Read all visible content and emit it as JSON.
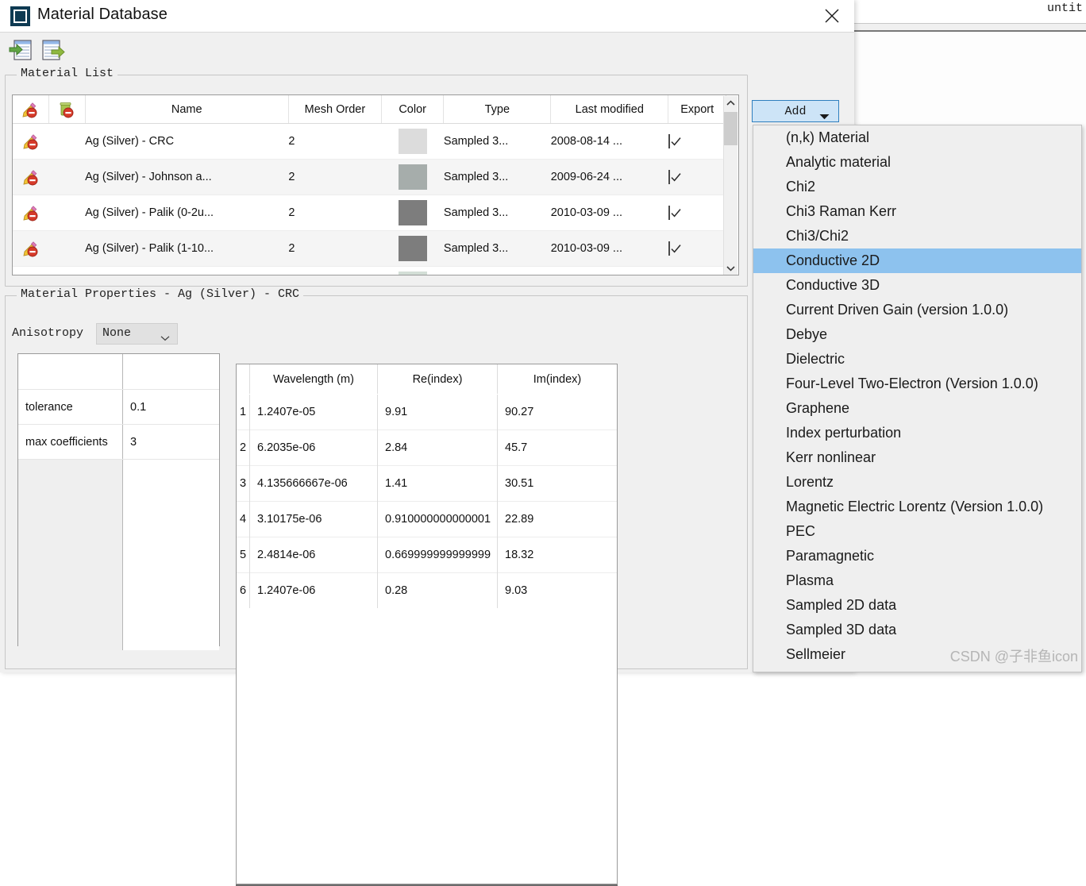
{
  "background_window": {
    "title": "untit"
  },
  "dialog": {
    "title": "Material Database",
    "icon": "app-window-icon",
    "close_label": "✕",
    "toolbar": [
      {
        "name": "import-material-button",
        "icon": "import-list-icon",
        "tooltip": "Import"
      },
      {
        "name": "export-material-button",
        "icon": "export-list-icon",
        "tooltip": "Export"
      }
    ]
  },
  "material_list": {
    "legend": "Material List",
    "columns": [
      "",
      "",
      "Name",
      "Mesh Order",
      "Color",
      "Type",
      "Last modified",
      "Export"
    ],
    "rows": [
      {
        "name": "Ag (Silver) - CRC",
        "mesh_order": "2",
        "color": "#dcdcdc",
        "type": "Sampled 3...",
        "last_modified": "2008-08-14 ...",
        "export": true
      },
      {
        "name": "Ag (Silver) - Johnson a...",
        "mesh_order": "2",
        "color": "#a6adab",
        "type": "Sampled 3...",
        "last_modified": "2009-06-24 ...",
        "export": true
      },
      {
        "name": "Ag (Silver) - Palik (0-2u...",
        "mesh_order": "2",
        "color": "#7d7d7d",
        "type": "Sampled 3...",
        "last_modified": "2010-03-09 ...",
        "export": true
      },
      {
        "name": "Ag (Silver) - Palik (1-10...",
        "mesh_order": "2",
        "color": "#7d7d7d",
        "type": "Sampled 3...",
        "last_modified": "2010-03-09 ...",
        "export": true
      },
      {
        "name": "",
        "mesh_order": "",
        "color": "#d3ded6",
        "type": "",
        "last_modified": "",
        "export": false
      }
    ],
    "scrollbar": {
      "up": "▲",
      "down": "▼"
    }
  },
  "material_properties": {
    "legend": "Material Properties - Ag (Silver) - CRC",
    "anisotropy": {
      "label": "Anisotropy",
      "value": "None"
    },
    "coefficients": [
      {
        "key": "tolerance",
        "value": "0.1"
      },
      {
        "key": "max coefficients",
        "value": "3"
      }
    ],
    "data_table": {
      "columns": [
        "Wavelength (m)",
        "Re(index)",
        "Im(index)"
      ],
      "rows": [
        {
          "index": "1",
          "wavelength": "1.2407e-05",
          "re_index": "9.91",
          "im_index": "90.27"
        },
        {
          "index": "2",
          "wavelength": "6.2035e-06",
          "re_index": "2.84",
          "im_index": "45.7"
        },
        {
          "index": "3",
          "wavelength": "4.135666667e-06",
          "re_index": "1.41",
          "im_index": "30.51"
        },
        {
          "index": "4",
          "wavelength": "3.10175e-06",
          "re_index": "0.910000000000001",
          "im_index": "22.89"
        },
        {
          "index": "5",
          "wavelength": "2.4814e-06",
          "re_index": "0.669999999999999",
          "im_index": "18.32"
        },
        {
          "index": "6",
          "wavelength": "1.2407e-06",
          "re_index": "0.28",
          "im_index": "9.03"
        }
      ]
    }
  },
  "add_control": {
    "button_label": "Add",
    "menu_items": [
      {
        "label": "(n,k) Material",
        "selected": false
      },
      {
        "label": "Analytic material",
        "selected": false
      },
      {
        "label": "Chi2",
        "selected": false
      },
      {
        "label": "Chi3 Raman Kerr",
        "selected": false
      },
      {
        "label": "Chi3/Chi2",
        "selected": false
      },
      {
        "label": "Conductive 2D",
        "selected": true
      },
      {
        "label": "Conductive 3D",
        "selected": false
      },
      {
        "label": "Current Driven Gain (version 1.0.0)",
        "selected": false
      },
      {
        "label": "Debye",
        "selected": false
      },
      {
        "label": "Dielectric",
        "selected": false
      },
      {
        "label": "Four-Level Two-Electron (Version 1.0.0)",
        "selected": false
      },
      {
        "label": "Graphene",
        "selected": false
      },
      {
        "label": "Index perturbation",
        "selected": false
      },
      {
        "label": "Kerr nonlinear",
        "selected": false
      },
      {
        "label": "Lorentz",
        "selected": false
      },
      {
        "label": "Magnetic Electric Lorentz (Version 1.0.0)",
        "selected": false
      },
      {
        "label": "PEC",
        "selected": false
      },
      {
        "label": "Paramagnetic",
        "selected": false
      },
      {
        "label": "Plasma",
        "selected": false
      },
      {
        "label": "Sampled 2D data",
        "selected": false
      },
      {
        "label": "Sampled 3D data",
        "selected": false
      },
      {
        "label": "Sellmeier",
        "selected": false
      }
    ],
    "selection_color": "#8dc2ee"
  },
  "watermark": "CSDN @子非鱼icon"
}
